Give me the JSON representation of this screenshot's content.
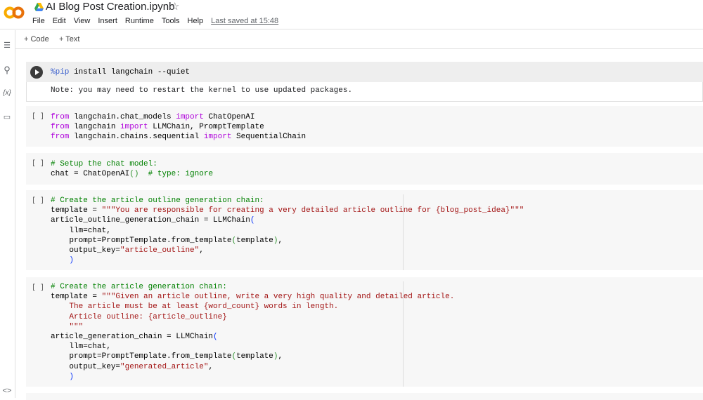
{
  "header": {
    "title": "AI Blog Post Creation.ipynb",
    "menu": [
      "File",
      "Edit",
      "View",
      "Insert",
      "Runtime",
      "Tools",
      "Help"
    ],
    "last_saved": "Last saved at 15:48"
  },
  "toolbar": {
    "add_code": "+ Code",
    "add_text": "+ Text"
  },
  "sidebar": {
    "icons": [
      "table-of-contents-icon",
      "search-icon",
      "variables-icon",
      "files-icon",
      "code-snippets-icon"
    ],
    "variables_glyph": "{x}",
    "snippets_glyph": "<>"
  },
  "cells": [
    {
      "bracket": "",
      "lines": [
        [
          [
            "%pip",
            "m"
          ],
          [
            " install langchain --quiet",
            ""
          ]
        ]
      ],
      "output": "Note: you may need to restart the kernel to use updated packages."
    },
    {
      "bracket": "[ ]",
      "lines": [
        [
          [
            "from",
            "k"
          ],
          [
            " langchain.chat_models ",
            ""
          ],
          [
            "import",
            "k"
          ],
          [
            " ChatOpenAI",
            ""
          ]
        ],
        [
          [
            "from",
            "k"
          ],
          [
            " langchain ",
            ""
          ],
          [
            "import",
            "k"
          ],
          [
            " LLMChain, PromptTemplate",
            ""
          ]
        ],
        [
          [
            "from",
            "k"
          ],
          [
            " langchain.chains.sequential ",
            ""
          ],
          [
            "import",
            "k"
          ],
          [
            " SequentialChain",
            ""
          ]
        ]
      ]
    },
    {
      "bracket": "[ ]",
      "lines": [
        [
          [
            "# Setup the chat model:",
            "c"
          ]
        ],
        [
          [
            "chat = ChatOpenAI",
            ""
          ],
          [
            "()",
            "g"
          ],
          [
            "  ",
            ""
          ],
          [
            "# type: ignore",
            "c"
          ]
        ]
      ]
    },
    {
      "bracket": "[ ]",
      "lines": [
        [
          [
            "# Create the article outline generation chain:",
            "c"
          ]
        ],
        [
          [
            "template = ",
            ""
          ],
          [
            "\"\"\"You are responsible for creating a very detailed article outline for {blog_post_idea}\"\"\"",
            "s"
          ]
        ],
        [
          [
            "article_outline_generation_chain = LLMChain",
            ""
          ],
          [
            "(",
            "p"
          ]
        ],
        [
          [
            "    llm=chat,",
            ""
          ]
        ],
        [
          [
            "    prompt=PromptTemplate.from_template",
            ""
          ],
          [
            "(",
            "g"
          ],
          [
            "template",
            ""
          ],
          [
            ")",
            "g"
          ],
          [
            ",",
            ""
          ]
        ],
        [
          [
            "    output_key=",
            ""
          ],
          [
            "\"article_outline\"",
            "s"
          ],
          [
            ",",
            ""
          ]
        ],
        [
          [
            "    ",
            ""
          ],
          [
            ")",
            "p"
          ]
        ]
      ]
    },
    {
      "bracket": "[ ]",
      "lines": [
        [
          [
            "# Create the article generation chain:",
            "c"
          ]
        ],
        [
          [
            "template = ",
            ""
          ],
          [
            "\"\"\"Given an article outline, write a very high quality and detailed article.",
            "s"
          ]
        ],
        [
          [
            "    The article must be at least {word_count} words in length.",
            "s"
          ]
        ],
        [
          [
            "    Article outline: {article_outline}",
            "s"
          ]
        ],
        [
          [
            "    \"\"\"",
            "s"
          ]
        ],
        [
          [
            "article_generation_chain = LLMChain",
            ""
          ],
          [
            "(",
            "p"
          ]
        ],
        [
          [
            "    llm=chat,",
            ""
          ]
        ],
        [
          [
            "    prompt=PromptTemplate.from_template",
            ""
          ],
          [
            "(",
            "g"
          ],
          [
            "template",
            ""
          ],
          [
            ")",
            "g"
          ],
          [
            ",",
            ""
          ]
        ],
        [
          [
            "    output_key=",
            ""
          ],
          [
            "\"generated_article\"",
            "s"
          ],
          [
            ",",
            ""
          ]
        ],
        [
          [
            "    ",
            ""
          ],
          [
            ")",
            "p"
          ]
        ]
      ]
    }
  ]
}
